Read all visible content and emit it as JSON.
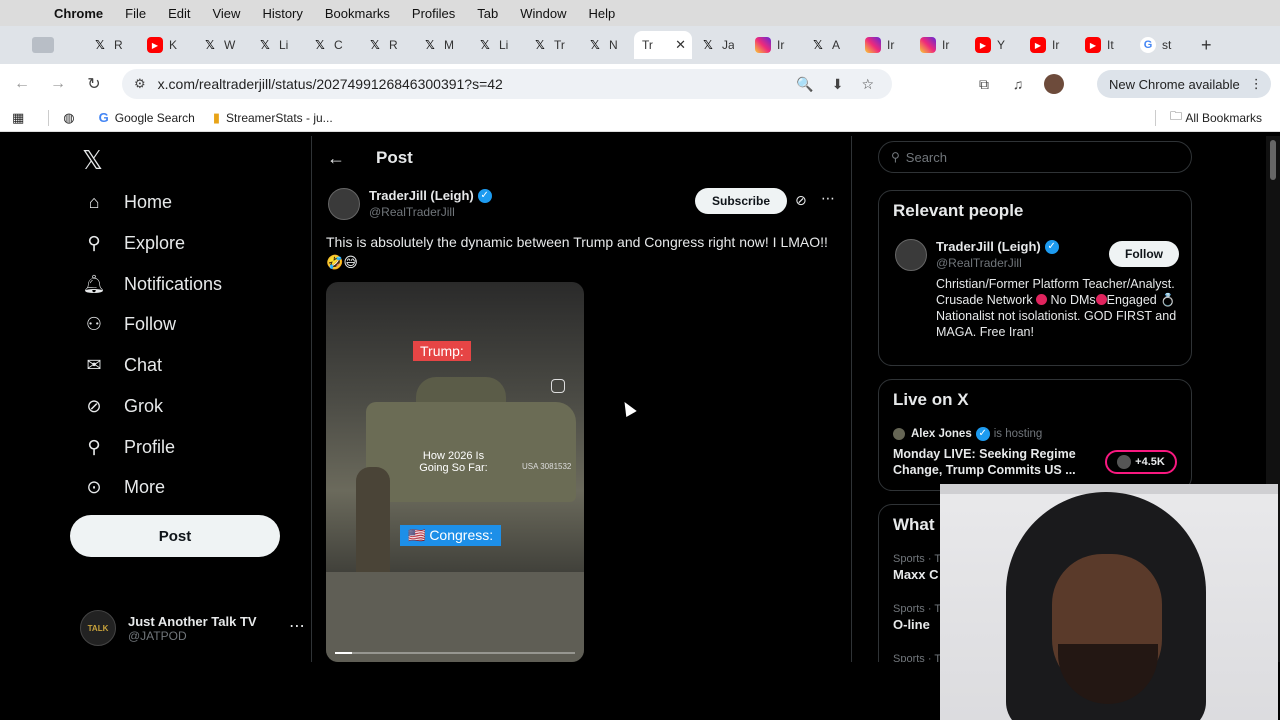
{
  "menubar": {
    "app": "Chrome",
    "items": [
      "File",
      "Edit",
      "View",
      "History",
      "Bookmarks",
      "Profiles",
      "Tab",
      "Window",
      "Help"
    ]
  },
  "tabs": [
    {
      "icon": "x",
      "label": "R"
    },
    {
      "icon": "yt",
      "label": "K"
    },
    {
      "icon": "x",
      "label": "W"
    },
    {
      "icon": "x",
      "label": "Li"
    },
    {
      "icon": "x",
      "label": "C"
    },
    {
      "icon": "x",
      "label": "R"
    },
    {
      "icon": "x",
      "label": "M"
    },
    {
      "icon": "x",
      "label": "Li"
    },
    {
      "icon": "x",
      "label": "Tr"
    },
    {
      "icon": "x",
      "label": "N"
    },
    {
      "icon": "active",
      "label": "Tr"
    },
    {
      "icon": "x",
      "label": "Ja"
    },
    {
      "icon": "ig",
      "label": "Ir"
    },
    {
      "icon": "x",
      "label": "A"
    },
    {
      "icon": "ig",
      "label": "Ir"
    },
    {
      "icon": "ig",
      "label": "Ir"
    },
    {
      "icon": "yt",
      "label": "Y"
    },
    {
      "icon": "yt",
      "label": "Ir"
    },
    {
      "icon": "yt",
      "label": "It"
    },
    {
      "icon": "g",
      "label": "st"
    }
  ],
  "address": {
    "url": "x.com/realtraderjill/status/2027499126846300391?s=42"
  },
  "new_chrome": "New Chrome available",
  "bookmarks": {
    "items": [
      "Google Search",
      "StreamerStats - ju..."
    ],
    "all": "All Bookmarks"
  },
  "leftnav": {
    "items": [
      "Home",
      "Explore",
      "Notifications",
      "Follow",
      "Chat",
      "Grok",
      "Profile",
      "More"
    ],
    "post_button": "Post",
    "account_name": "Just Another Talk TV",
    "account_handle": "@JATPOD",
    "account_avatar_text": "TALK"
  },
  "post": {
    "header": "Post",
    "author_name": "TraderJill (Leigh)",
    "author_handle": "@RealTraderJill",
    "subscribe": "Subscribe",
    "text": "This is absolutely the dynamic between Trump and Congress right now! I LMAO!! 🤣😅",
    "media": {
      "tag_top": "Trump:",
      "caption": "How 2026 Is Going So Far:",
      "tank_text": "USA 3081532",
      "tag_bottom": "🇺🇸 Congress:",
      "progress": 0.07
    }
  },
  "right": {
    "search_placeholder": "Search",
    "relevant_title": "Relevant people",
    "rp_name": "TraderJill (Leigh)",
    "rp_handle": "@RealTraderJill",
    "rp_follow": "Follow",
    "rp_bio_1": "Christian/Former Platform Teacher/Analyst. Crusade Network ",
    "rp_bio_2": " No DMs",
    "rp_bio_3": "Engaged 💍 Nationalist not isolationist. GOD FIRST and MAGA. Free Iran!",
    "live_title": "Live on X",
    "live_host": "Alex Jones",
    "live_hosting": "is hosting",
    "live_show": "Monday LIVE: Seeking Regime Change, Trump Commits US ...",
    "live_count": "+4.5K",
    "whats_title": "What",
    "trends": [
      {
        "cat": "Sports · T",
        "name": "Maxx C"
      },
      {
        "cat": "Sports · T",
        "name": "O-line"
      },
      {
        "cat": "Sports · T",
        "name": ""
      }
    ]
  },
  "colors": {
    "accent": "#1d9bf0",
    "live_ring": "#f91880",
    "trump_tag": "#e64545",
    "congress_tag": "#1d8fe8"
  }
}
